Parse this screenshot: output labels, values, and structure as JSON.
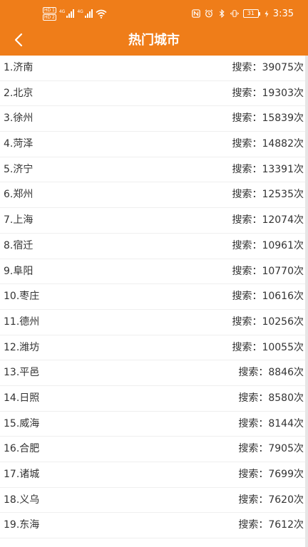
{
  "status_bar": {
    "hd1": "HD 1",
    "hd2": "HD 2",
    "net1": "4G",
    "net2": "4G",
    "battery": "31",
    "time": "3:35"
  },
  "header": {
    "title": "热门城市",
    "back_icon": "chevron-left-icon",
    "color": "#ef7d19"
  },
  "cities": [
    {
      "city": "1.济南",
      "count": "搜索：39075次"
    },
    {
      "city": "2.北京",
      "count": "搜索：19303次"
    },
    {
      "city": "3.徐州",
      "count": "搜索：15839次"
    },
    {
      "city": "4.菏泽",
      "count": "搜索：14882次"
    },
    {
      "city": "5.济宁",
      "count": "搜索：13391次"
    },
    {
      "city": "6.郑州",
      "count": "搜索：12535次"
    },
    {
      "city": "7.上海",
      "count": "搜索：12074次"
    },
    {
      "city": "8.宿迁",
      "count": "搜索：10961次"
    },
    {
      "city": "9.阜阳",
      "count": "搜索：10770次"
    },
    {
      "city": "10.枣庄",
      "count": "搜索：10616次"
    },
    {
      "city": "11.德州",
      "count": "搜索：10256次"
    },
    {
      "city": "12.潍坊",
      "count": "搜索：10055次"
    },
    {
      "city": "13.平邑",
      "count": "搜索：8846次"
    },
    {
      "city": "14.日照",
      "count": "搜索：8580次"
    },
    {
      "city": "15.威海",
      "count": "搜索：8144次"
    },
    {
      "city": "16.合肥",
      "count": "搜索：7905次"
    },
    {
      "city": "17.诸城",
      "count": "搜索：7699次"
    },
    {
      "city": "18.义乌",
      "count": "搜索：7620次"
    },
    {
      "city": "19.东海",
      "count": "搜索：7612次"
    }
  ]
}
